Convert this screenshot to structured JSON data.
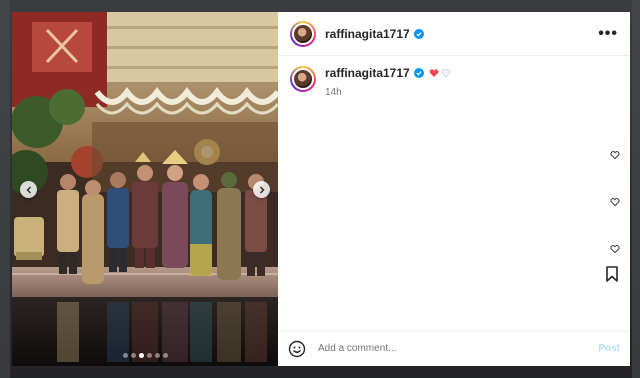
{
  "post": {
    "username": "raffinagita1717",
    "caption_username": "raffinagita1717",
    "time": "14h",
    "more_label": "•••"
  },
  "comment_box": {
    "placeholder": "Add a comment...",
    "post_label": "Post"
  },
  "carousel": {
    "slide_count": 6,
    "active_index": 0
  },
  "colors": {
    "verified": "#0095f6",
    "heart": "#ed4956",
    "post_disabled": "#b2dffc"
  }
}
